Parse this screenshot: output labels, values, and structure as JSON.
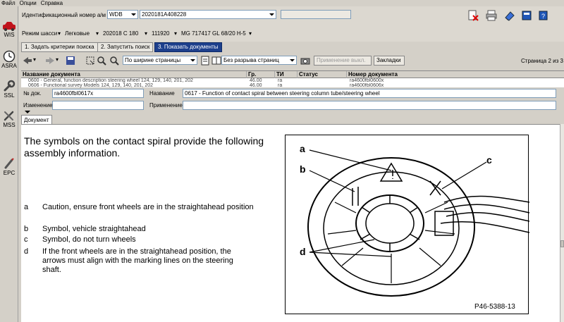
{
  "menu": {
    "items": [
      "Файл",
      "Опции",
      "Справка"
    ]
  },
  "sidebar": {
    "items": [
      {
        "label": "WIS"
      },
      {
        "label": "ASRA"
      },
      {
        "label": "SSL"
      },
      {
        "label": "MSS"
      },
      {
        "label": "EPC"
      }
    ]
  },
  "header": {
    "vin_label": "Идентификационный номер а/м",
    "vin_prefix": "WDB",
    "vin_value": "2020181A408228",
    "chassis_label": "Режим шасси",
    "chassis_value": "Легковые",
    "model_value": "202018 C 180",
    "engine_value": "111920",
    "transmission_value": "MG 717417 GL 68/20 H-5"
  },
  "steps": [
    {
      "label": "1. Задать критерии поиска"
    },
    {
      "label": "2. Запустить поиск"
    },
    {
      "label": "3. Показать документы"
    }
  ],
  "toolbar": {
    "zoom_select": "По ширине страницы",
    "pagebreak_select": "Без разрыва страниц",
    "apply_button": "Применение выкл.",
    "bookmarks_button": "Закладки",
    "page_status": "Страница 2 из 3"
  },
  "grid": {
    "columns": [
      "Название документа",
      "Гр.",
      "ТИ",
      "Статус",
      "Номер документа"
    ],
    "rows": [
      {
        "title": "0600 - General, function description steering wheel 124, 129, 140, 201, 202",
        "group": "46.00",
        "ti": "ra",
        "status": "",
        "number": "ra4600fbl0600x"
      },
      {
        "title": "0606 - Functional survey Models 124, 129, 140, 201, 202",
        "group": "46.00",
        "ti": "ra",
        "status": "",
        "number": "ra4600fbl0606x"
      }
    ]
  },
  "details": {
    "docno_label": "№ док.",
    "docno_value": "ra4600fbl0617x",
    "title_label": "Название",
    "title_value": "0617 - Function of contact spiral between steering column tube/steering wheel",
    "change_label": "Изменение",
    "change_value": "",
    "apply_label": "Применение",
    "apply_value": ""
  },
  "document": {
    "tab_label": "Документ",
    "intro": "The symbols on the contact spiral provide the following assembly information.",
    "legend": [
      {
        "key": "a",
        "text": "Caution, ensure front wheels are in the straightahead position"
      },
      {
        "key": "b",
        "text": "Symbol, vehicle straightahead"
      },
      {
        "key": "c",
        "text": "Symbol, do not turn wheels"
      },
      {
        "key": "d",
        "text": "If the front wheels are in the straightahead position, the arrows must align with the marking lines on the steering shaft."
      }
    ],
    "figure": {
      "labels": [
        "a",
        "b",
        "c",
        "d"
      ],
      "caption": "P46-5388-13"
    }
  },
  "colors": {
    "active_tab": "#1d3f8c",
    "sidebar_bg": "#d4d0c8",
    "doc_bg": "#ffffff"
  }
}
